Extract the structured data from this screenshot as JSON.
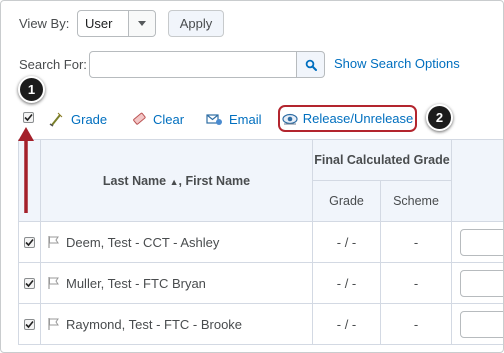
{
  "filters": {
    "view_by_label": "View By:",
    "view_by_value": "User",
    "apply_label": "Apply",
    "search_label": "Search For:",
    "search_value": "",
    "search_placeholder": "",
    "search_options_label": "Show Search Options"
  },
  "callouts": [
    "1",
    "2"
  ],
  "toolbar": {
    "grade_label": "Grade",
    "clear_label": "Clear",
    "email_label": "Email",
    "release_label": "Release/Unrelease",
    "select_all_checked": true
  },
  "table": {
    "name_header": "Last Name",
    "name_header_sep": ", First Name",
    "sort_indicator": "▲",
    "final_grade_header": "Final Calculated Grade",
    "grade_header": "Grade",
    "scheme_header": "Scheme",
    "rows": [
      {
        "name": "Deem, Test - CCT - Ashley",
        "grade": "- / -",
        "scheme": "-",
        "checked": true
      },
      {
        "name": "Muller, Test - FTC Bryan",
        "grade": "- / -",
        "scheme": "-",
        "checked": true
      },
      {
        "name": "Raymond, Test - FTC - Brooke",
        "grade": "- / -",
        "scheme": "-",
        "checked": true
      }
    ]
  },
  "colors": {
    "link": "#006fbf",
    "highlight_border": "#b3252e",
    "arrow": "#a4202a",
    "header_bg": "#f1f5fb"
  }
}
